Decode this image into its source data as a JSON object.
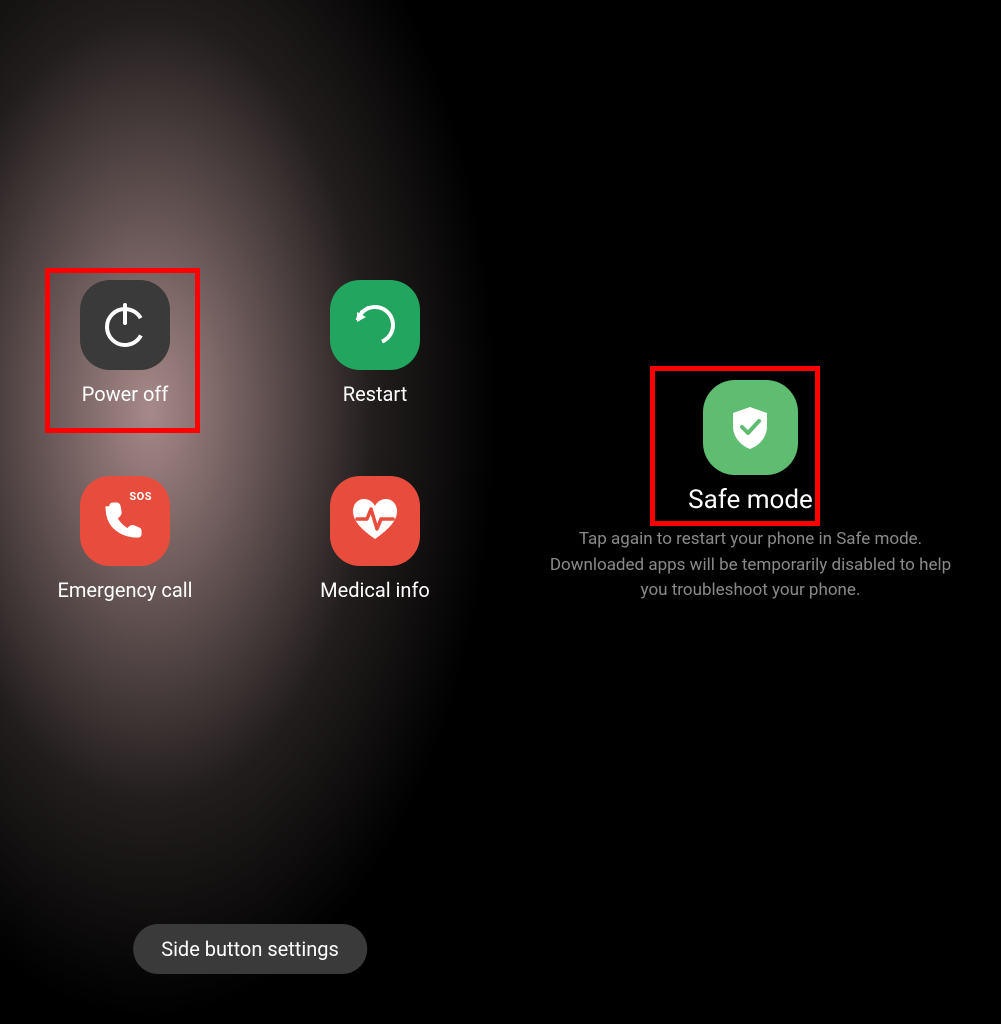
{
  "left": {
    "power_off_label": "Power off",
    "restart_label": "Restart",
    "emergency_label": "Emergency call",
    "medical_label": "Medical info",
    "sos": "SOS",
    "bottom_button": "Side button settings"
  },
  "right": {
    "safe_mode_label": "Safe mode",
    "description": "Tap again to restart your phone in Safe mode. Downloaded apps will be temporarily disabled to help you troubleshoot your phone."
  }
}
